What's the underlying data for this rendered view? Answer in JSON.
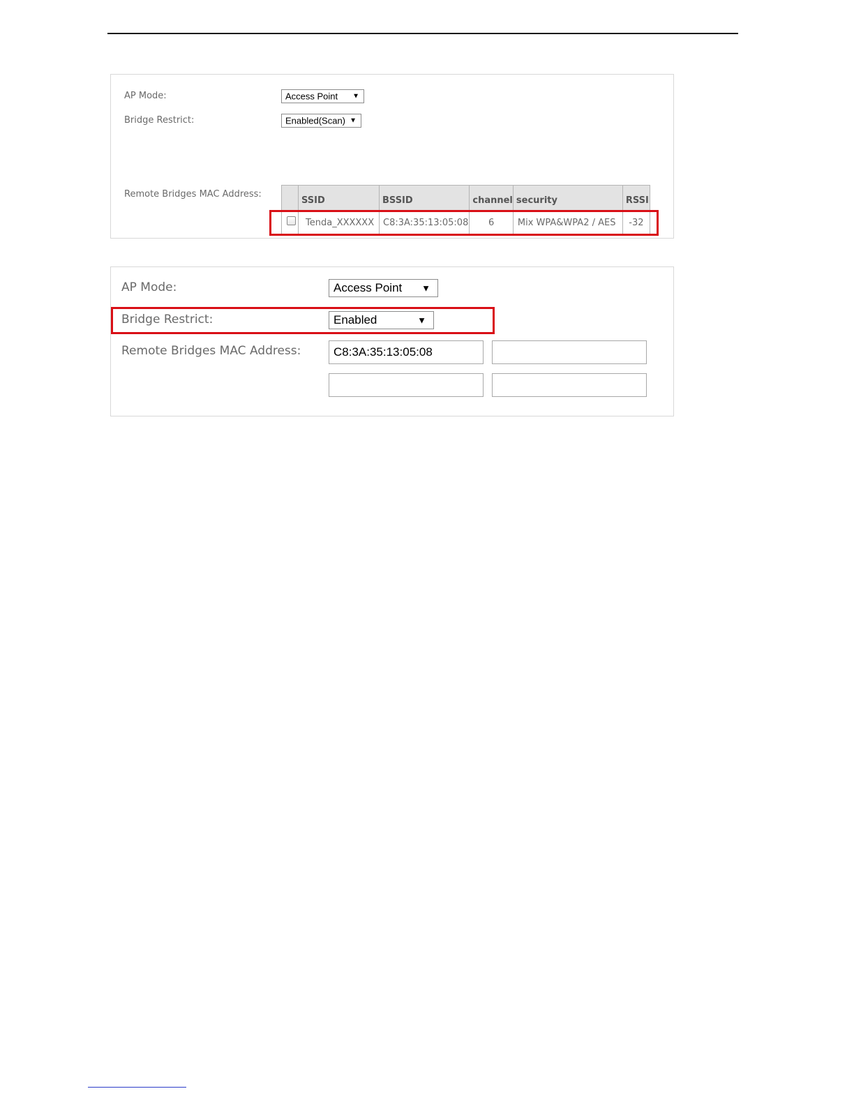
{
  "screen1": {
    "ap_mode": {
      "label": "AP Mode:",
      "value": "Access Point"
    },
    "bridge_restrict": {
      "label": "Bridge Restrict:",
      "value": "Enabled(Scan)"
    },
    "remote_bridges": {
      "label": "Remote Bridges MAC Address:",
      "table": {
        "headers": {
          "ssid": "SSID",
          "bssid": "BSSID",
          "channel": "channel",
          "security": "security",
          "rssi": "RSSI"
        },
        "rows": [
          {
            "ssid": "Tenda_XXXXXX",
            "bssid": "C8:3A:35:13:05:08",
            "channel": "6",
            "security": "Mix WPA&WPA2 / AES",
            "rssi": "-32",
            "checked": false
          }
        ]
      }
    }
  },
  "screen2": {
    "ap_mode": {
      "label": "AP Mode:",
      "value": "Access Point"
    },
    "bridge_restrict": {
      "label": "Bridge Restrict:",
      "value": "Enabled"
    },
    "remote_bridges": {
      "label": "Remote Bridges MAC Address:",
      "mac_1": "C8:3A:35:13:05:08",
      "mac_2": "",
      "mac_3": "",
      "mac_4": ""
    }
  },
  "icons": {
    "dropdown": "dropdown-arrow-icon",
    "checkbox": "checkbox-icon"
  },
  "colors": {
    "highlight": "#d90f16",
    "header_bg": "#e3e3e3",
    "label_text": "#6a6a6a"
  }
}
